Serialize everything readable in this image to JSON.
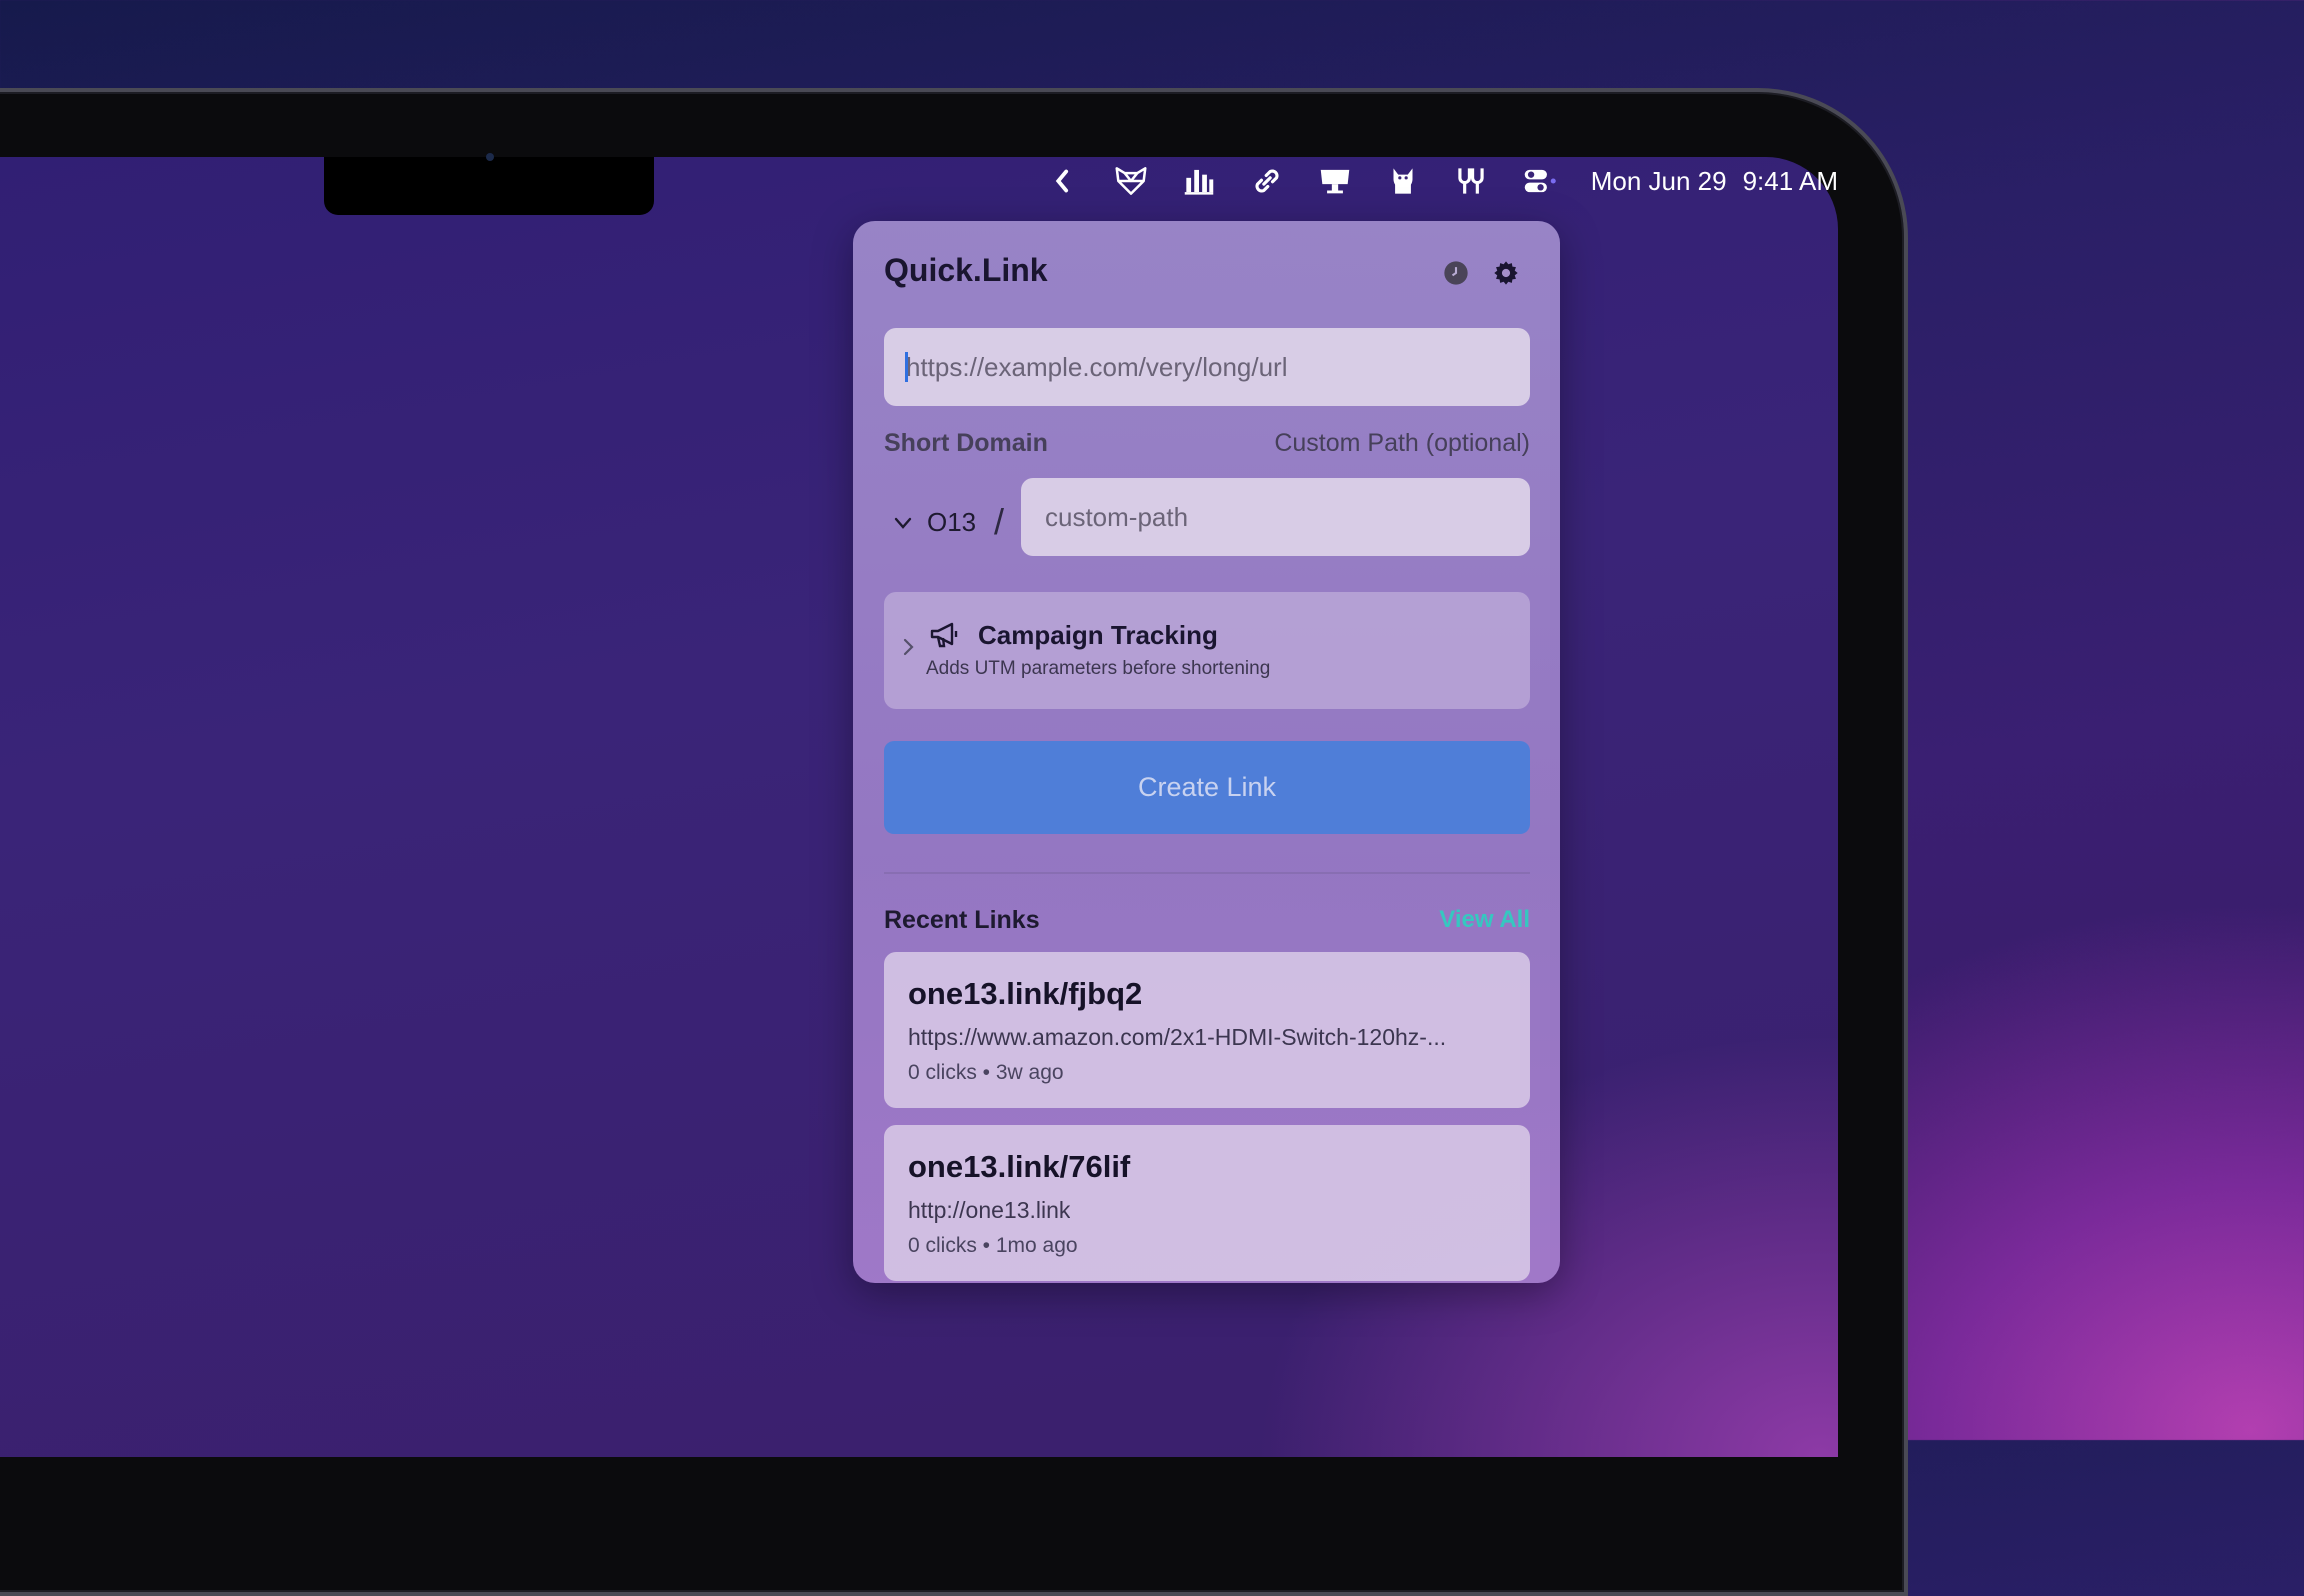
{
  "menubar": {
    "items": [
      {
        "icon": "chevron-left-icon"
      },
      {
        "icon": "fox-icon"
      },
      {
        "icon": "bar-chart-icon"
      },
      {
        "icon": "link-icon"
      },
      {
        "icon": "display-icon"
      },
      {
        "icon": "cat-icon"
      },
      {
        "icon": "tuning-fork-icon"
      },
      {
        "icon": "control-center-icon"
      }
    ],
    "date": "Mon Jun 29",
    "time": "9:41 AM"
  },
  "popover": {
    "title": "Quick.Link",
    "history_icon": "clock-icon",
    "settings_icon": "gear-icon",
    "url_placeholder": "https://example.com/very/long/url",
    "short_domain_label": "Short Domain",
    "custom_path_label": "Custom Path (optional)",
    "selected_domain": "O13",
    "separator": "/",
    "custom_path_placeholder": "custom-path",
    "campaign": {
      "title": "Campaign Tracking",
      "subtitle": "Adds UTM parameters before shortening"
    },
    "create_button": "Create Link",
    "recent_title": "Recent Links",
    "view_all": "View All",
    "recent_links": [
      {
        "short": "one13.link/fjbq2",
        "url": "https://www.amazon.com/2x1-HDMI-Switch-120hz-...",
        "meta": "0 clicks • 3w ago"
      },
      {
        "short": "one13.link/76lif",
        "url": "http://one13.link",
        "meta": "0 clicks • 1mo ago"
      }
    ],
    "accent_color": "#4f7ed8",
    "link_color": "#36c7c0"
  }
}
